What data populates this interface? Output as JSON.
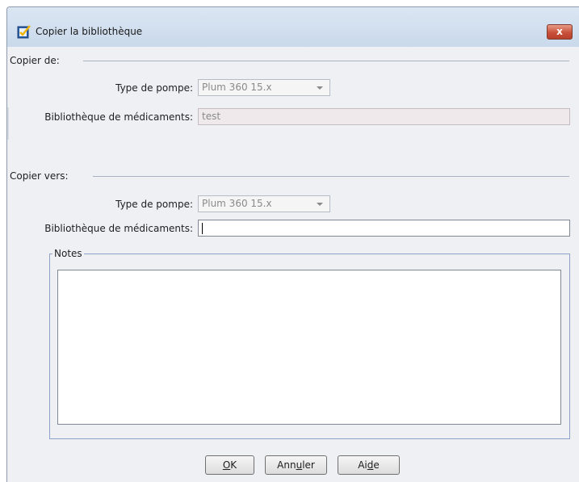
{
  "window": {
    "title": "Copier la bibliothèque",
    "close_glyph": "x"
  },
  "copy_from": {
    "section_label": "Copier de:",
    "pump_type_label": "Type de pompe:",
    "pump_type_value": "Plum 360 15.x",
    "library_label": "Bibliothèque de médicaments:",
    "library_value": "test"
  },
  "copy_to": {
    "section_label": "Copier vers:",
    "pump_type_label": "Type de pompe:",
    "pump_type_value": "Plum 360 15.x",
    "library_label": "Bibliothèque de médicaments:",
    "library_value": ""
  },
  "notes": {
    "legend": "Notes",
    "value": ""
  },
  "buttons": {
    "ok": {
      "pre": "",
      "mnemonic": "O",
      "post": "K"
    },
    "cancel": {
      "pre": "Ann",
      "mnemonic": "u",
      "post": "ler"
    },
    "help": {
      "pre": "Ai",
      "mnemonic": "d",
      "post": "e"
    }
  },
  "icons": {
    "title_icon": "checked-document-icon",
    "close_icon": "close-icon",
    "dropdown_icon": "chevron-down-icon"
  },
  "colors": {
    "title_bar": "#c9d9eb",
    "close_button": "#c9513a",
    "notes_border": "#8ea1c6"
  }
}
